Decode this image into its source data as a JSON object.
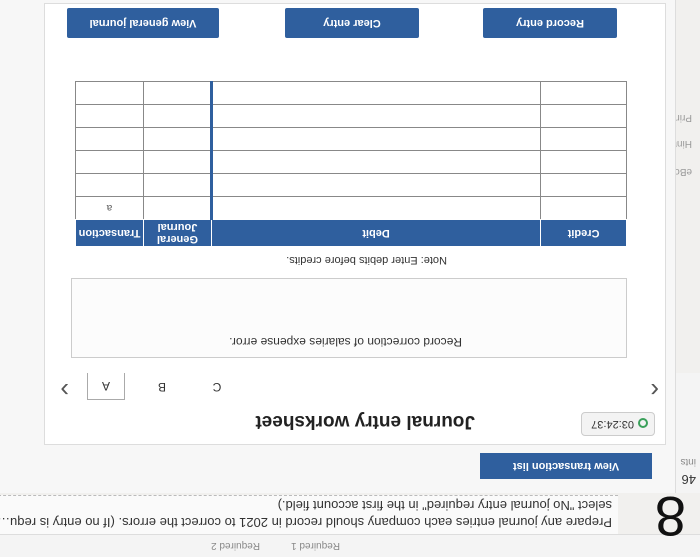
{
  "tabs": [
    "Required 1",
    "Required 2"
  ],
  "question_number": "8",
  "instructions": "Prepare any journal entries each company should record in 2021 to correct the errors. (If no entry is requ… select \"No journal entry required\" in the first account field.)",
  "sidebar": {
    "points_label": "ints",
    "points_value": "46",
    "links": [
      "eBook",
      "Hint",
      "Print"
    ]
  },
  "view_transaction_list": "View transaction list",
  "timer": "03:24:37",
  "worksheet_title": "Journal entry worksheet",
  "nav_tabs": [
    "A",
    "B",
    "C"
  ],
  "active_nav_tab": "A",
  "entry_description": "Record correction of salaries expense error.",
  "note": "Note: Enter debits before credits.",
  "table": {
    "headers": [
      "Transaction",
      "General Journal",
      "Debit",
      "Credit"
    ],
    "rows": [
      [
        "a",
        "",
        "",
        ""
      ],
      [
        "",
        "",
        "",
        ""
      ],
      [
        "",
        "",
        "",
        ""
      ],
      [
        "",
        "",
        "",
        ""
      ],
      [
        "",
        "",
        "",
        ""
      ],
      [
        "",
        "",
        "",
        ""
      ]
    ]
  },
  "buttons": {
    "record": "Record entry",
    "clear": "Clear entry",
    "view_journal": "View general journal"
  }
}
